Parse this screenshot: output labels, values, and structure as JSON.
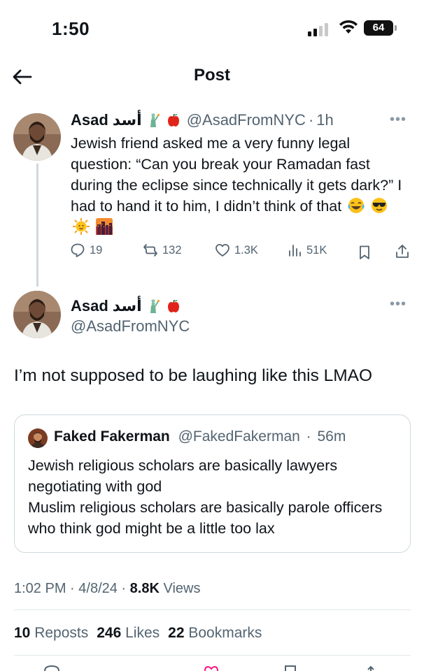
{
  "status_bar": {
    "time": "1:50",
    "battery": "64"
  },
  "header": {
    "title": "Post"
  },
  "parent_post": {
    "display_name": "Asad",
    "arabic_name": "أسد",
    "handle": "@AsadFromNYC",
    "separator": "·",
    "time_ago": "1h",
    "text": "Jewish friend asked me a very funny legal question: “Can you break your Ramadan fast during the eclipse since technically it gets dark?” I had to hand it to him, I didn’t think of that",
    "emojis": [
      "laughing-face-icon",
      "sunglasses-face-icon",
      "sun-face-icon",
      "city-dusk-icon"
    ],
    "actions": {
      "replies": "19",
      "reposts": "132",
      "likes": "1.3K",
      "views": "51K"
    }
  },
  "main_post": {
    "display_name": "Asad",
    "arabic_name": "أسد",
    "handle": "@AsadFromNYC",
    "text": "I’m not supposed to be laughing like this LMAO",
    "quote": {
      "display_name": "Faked Fakerman",
      "handle": "@FakedFakerman",
      "separator": "·",
      "time_ago": "56m",
      "text_line1": "Jewish religious scholars are basically lawyers negotiating with god",
      "text_line2": "Muslim religious scholars are basically parole officers who think god might be a little too lax"
    },
    "timestamp": {
      "time": "1:02 PM",
      "sep1": " · ",
      "date": "4/8/24",
      "sep2": " · ",
      "views_count": "8.8K",
      "views_label": " Views"
    },
    "stats": {
      "reposts_count": "10",
      "reposts_label": " Reposts",
      "likes_count": "246",
      "likes_label": " Likes",
      "bookmarks_count": "22",
      "bookmarks_label": " Bookmarks"
    }
  },
  "colors": {
    "text": "#0f1419",
    "secondary": "#536471",
    "border": "#cfd9de"
  }
}
